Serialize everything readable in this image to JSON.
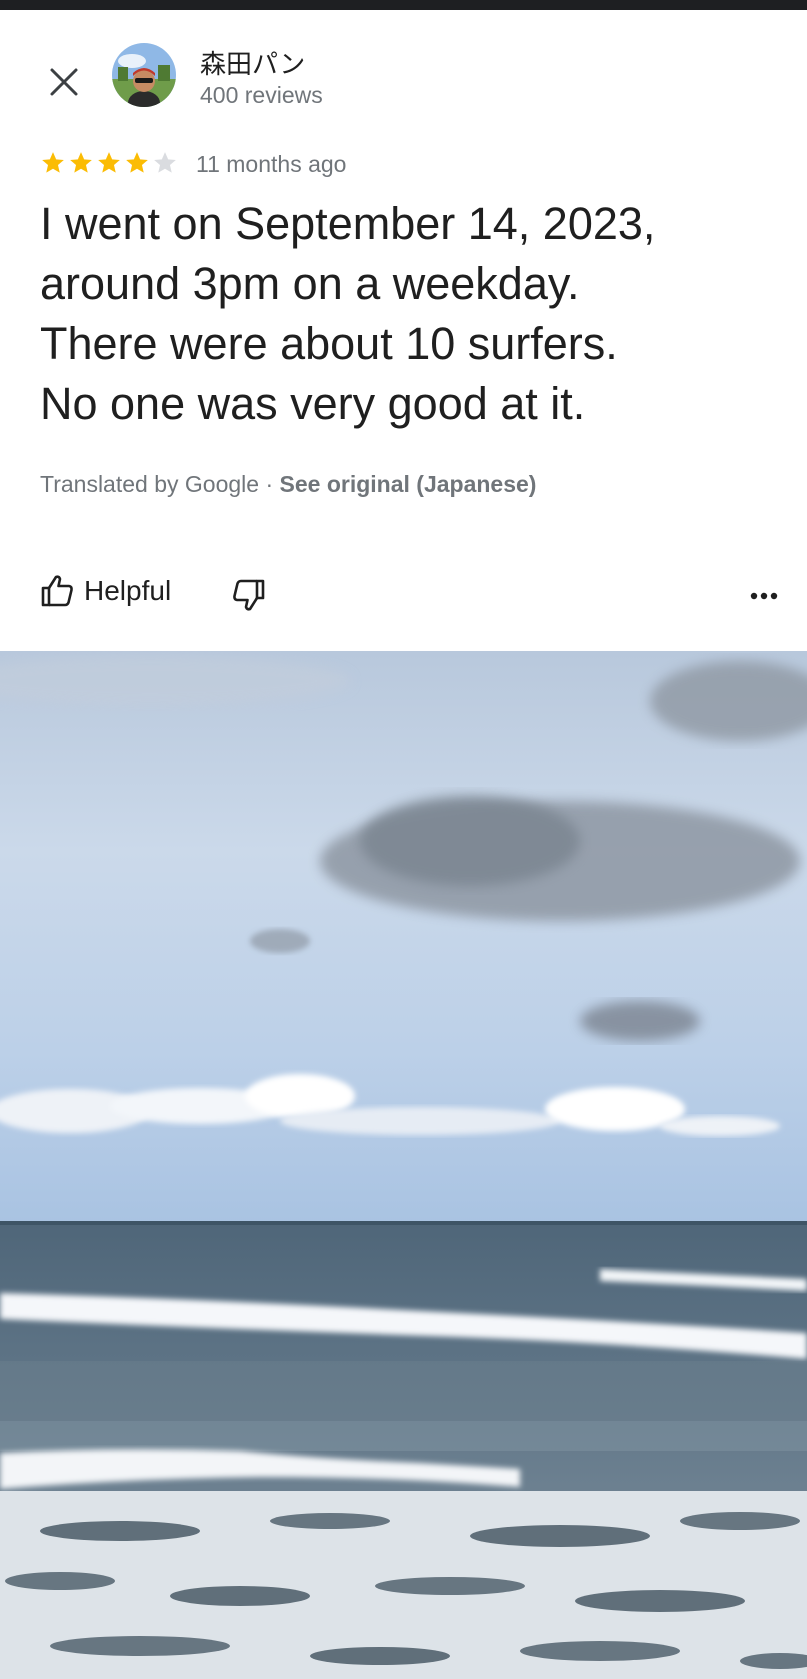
{
  "review": {
    "author": {
      "name": "森田パン",
      "meta": "400 reviews",
      "avatar_icon": "avatar-photo"
    },
    "rating": 4,
    "max_rating": 5,
    "time": "11 months ago",
    "text": "I went on September 14, 2023,\naround 3pm on a weekday.\nThere were about 10 surfers.\nNo one was very good at it.",
    "translation": {
      "prefix": "Translated by Google",
      "separator": "·",
      "see_original": "See original (Japanese)"
    }
  },
  "actions": {
    "helpful_label": "Helpful",
    "helpful_icon": "thumbs-up-icon",
    "unhelpful_icon": "thumbs-down-icon",
    "more_icon": "more-icon",
    "close_icon": "close-icon"
  },
  "photo": {
    "subject": "ocean-waves-beach-photo"
  },
  "colors": {
    "star_filled": "#fbbc04",
    "star_empty": "#dadce0",
    "text_primary": "#1f1f1f",
    "text_secondary": "#70757a"
  }
}
